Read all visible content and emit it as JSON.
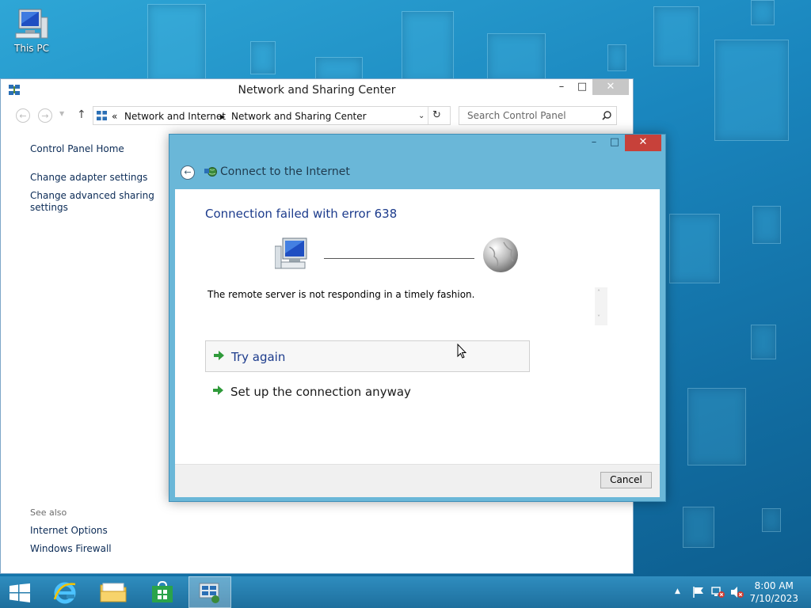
{
  "desktop": {
    "icons": [
      {
        "label": "This PC",
        "icon": "computer-icon"
      }
    ]
  },
  "explorer": {
    "title": "Network and Sharing Center",
    "address": {
      "prefix": "«",
      "crumbs": [
        "Network and Internet",
        "Network and Sharing Center"
      ]
    },
    "search_placeholder": "Search Control Panel",
    "sidebar": {
      "links": [
        "Control Panel Home",
        "Change adapter settings",
        "Change advanced sharing settings"
      ],
      "see_also_label": "See also",
      "see_also": [
        "Internet Options",
        "Windows Firewall"
      ]
    }
  },
  "dialog": {
    "title": "Connect to the Internet",
    "error_heading": "Connection failed with error 638",
    "message": "The remote server is not responding in a timely fashion.",
    "options": [
      "Try again",
      "Set up the connection anyway"
    ],
    "cancel_label": "Cancel"
  },
  "taskbar": {
    "time": "8:00 AM",
    "date": "7/10/2023"
  },
  "colors": {
    "accent": "#6ab7d8",
    "link": "#1c3b8c",
    "close": "#c7413a"
  }
}
